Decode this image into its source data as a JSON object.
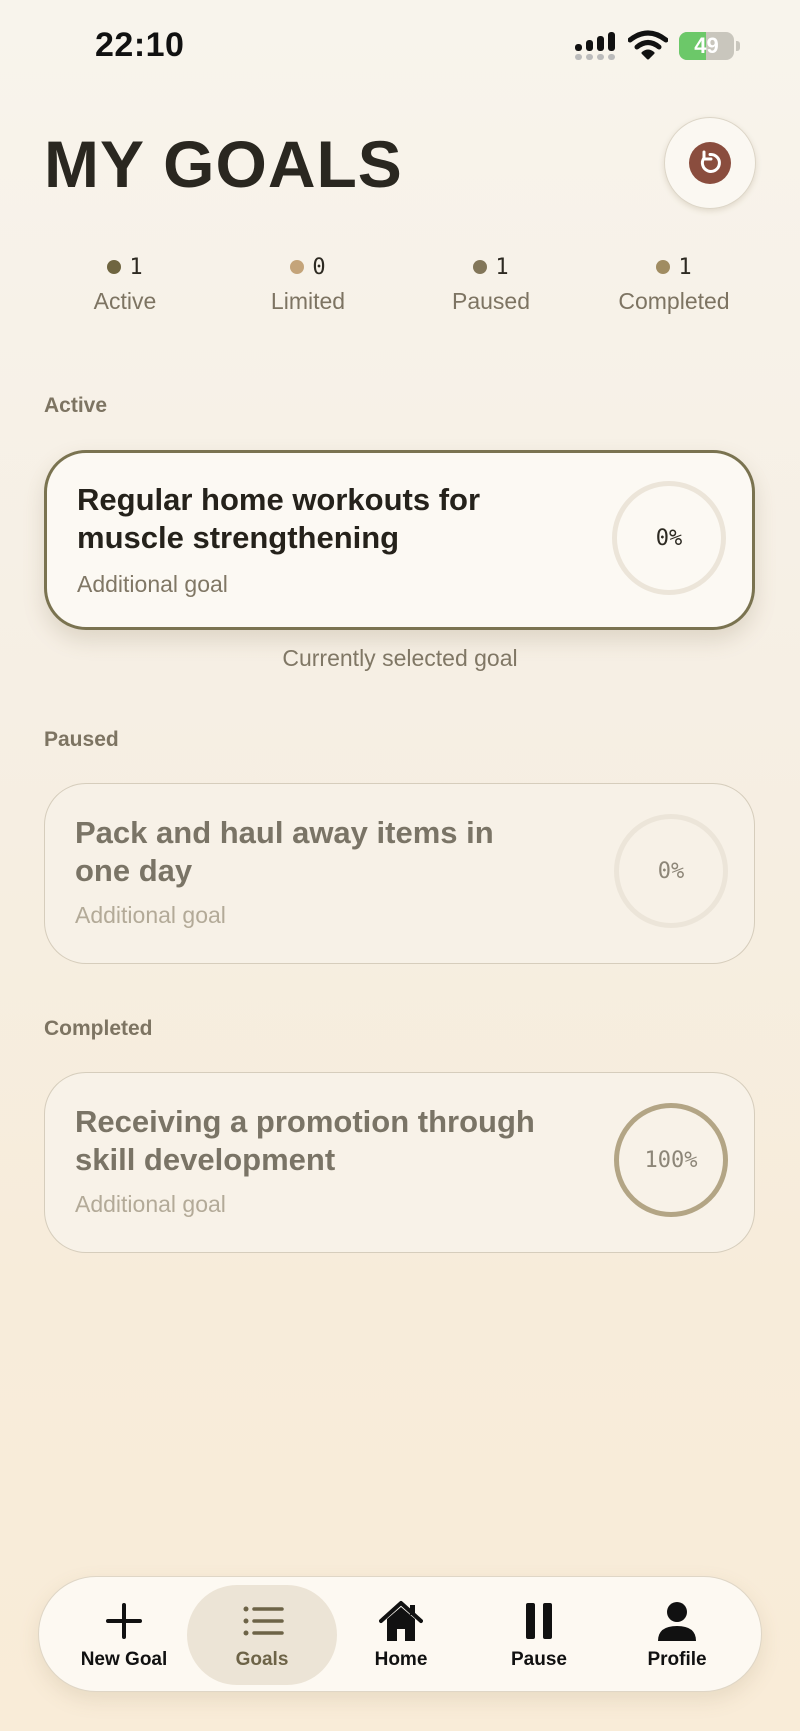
{
  "status_bar": {
    "time": "22:10",
    "battery": "49"
  },
  "header": {
    "title": "MY GOALS"
  },
  "stats": [
    {
      "count": "1",
      "label": "Active",
      "dot_color": "#6f6540"
    },
    {
      "count": "0",
      "label": "Limited",
      "dot_color": "#c4a47a"
    },
    {
      "count": "1",
      "label": "Paused",
      "dot_color": "#827659"
    },
    {
      "count": "1",
      "label": "Completed",
      "dot_color": "#a08c62"
    }
  ],
  "sections": {
    "active": {
      "label": "Active",
      "goal": {
        "title": "Regular home workouts for muscle strengthening",
        "subtitle": "Additional goal",
        "progress": "0%"
      },
      "caption": "Currently selected goal"
    },
    "paused": {
      "label": "Paused",
      "goal": {
        "title": "Pack and haul away items in one day",
        "subtitle": "Additional goal",
        "progress": "0%"
      }
    },
    "completed": {
      "label": "Completed",
      "goal": {
        "title": "Receiving a promotion through skill development",
        "subtitle": "Additional goal",
        "progress": "100%"
      }
    }
  },
  "nav": {
    "items": [
      {
        "label": "New Goal",
        "icon": "plus-icon"
      },
      {
        "label": "Goals",
        "icon": "list-icon"
      },
      {
        "label": "Home",
        "icon": "home-icon"
      },
      {
        "label": "Pause",
        "icon": "pause-icon"
      },
      {
        "label": "Profile",
        "icon": "person-icon"
      }
    ],
    "selected": "Goals"
  },
  "colors": {
    "accent": "#7a7350",
    "refresh": "#8a4d3e",
    "battery": "#6cc869"
  }
}
